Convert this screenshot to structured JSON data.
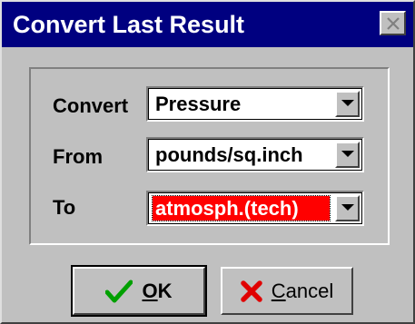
{
  "dialog": {
    "title": "Convert Last Result"
  },
  "icons": {
    "close": "close-icon",
    "dropdown": "chevron-down-icon",
    "ok": "checkmark-icon",
    "cancel": "x-icon"
  },
  "fields": {
    "convert": {
      "label": "Convert",
      "value": "Pressure"
    },
    "from": {
      "label": "From",
      "value": "pounds/sq.inch"
    },
    "to": {
      "label": "To",
      "value": "atmosph.(tech)"
    }
  },
  "buttons": {
    "ok": {
      "mnemonic": "O",
      "rest": "K"
    },
    "cancel": {
      "mnemonic": "C",
      "rest": "ancel"
    }
  },
  "colors": {
    "title_bar": "#000080",
    "face": "#c0c0c0",
    "selection": "#ff0000",
    "check_green": "#00a000",
    "cancel_red": "#e00000"
  }
}
